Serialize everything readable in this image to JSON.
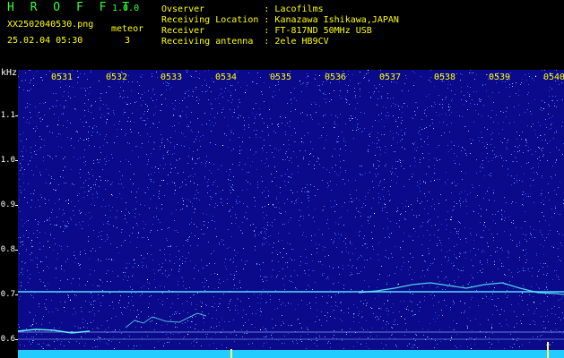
{
  "header": {
    "app_name": "H R O F F T",
    "app_version": "1.0.0",
    "filename": "XX2502040530.png",
    "datetime": "25.02.04 05:30",
    "meteor_label": "meteor",
    "meteor_count": "3",
    "info_lines": [
      "Ovserver           : Lacofilms",
      "Receiving Location : Kanazawa Ishikawa,JAPAN",
      "Receiver           : FT-817ND 50MHz USB",
      "Receiving antenna  : 2ele HB9CV"
    ]
  },
  "spectrogram": {
    "y_unit": "kHz",
    "y_ticks": [
      "1.1",
      "1.0",
      "0.9",
      "0.8",
      "0.7",
      "0.6"
    ],
    "time_labels": [
      "0531",
      "0532",
      "0533",
      "0534",
      "0535",
      "0536",
      "0537",
      "0538",
      "0539",
      "0540"
    ],
    "colors": {
      "background": "#0a0a8a",
      "noise": "#3355ff",
      "signal": "#66ffff"
    }
  }
}
